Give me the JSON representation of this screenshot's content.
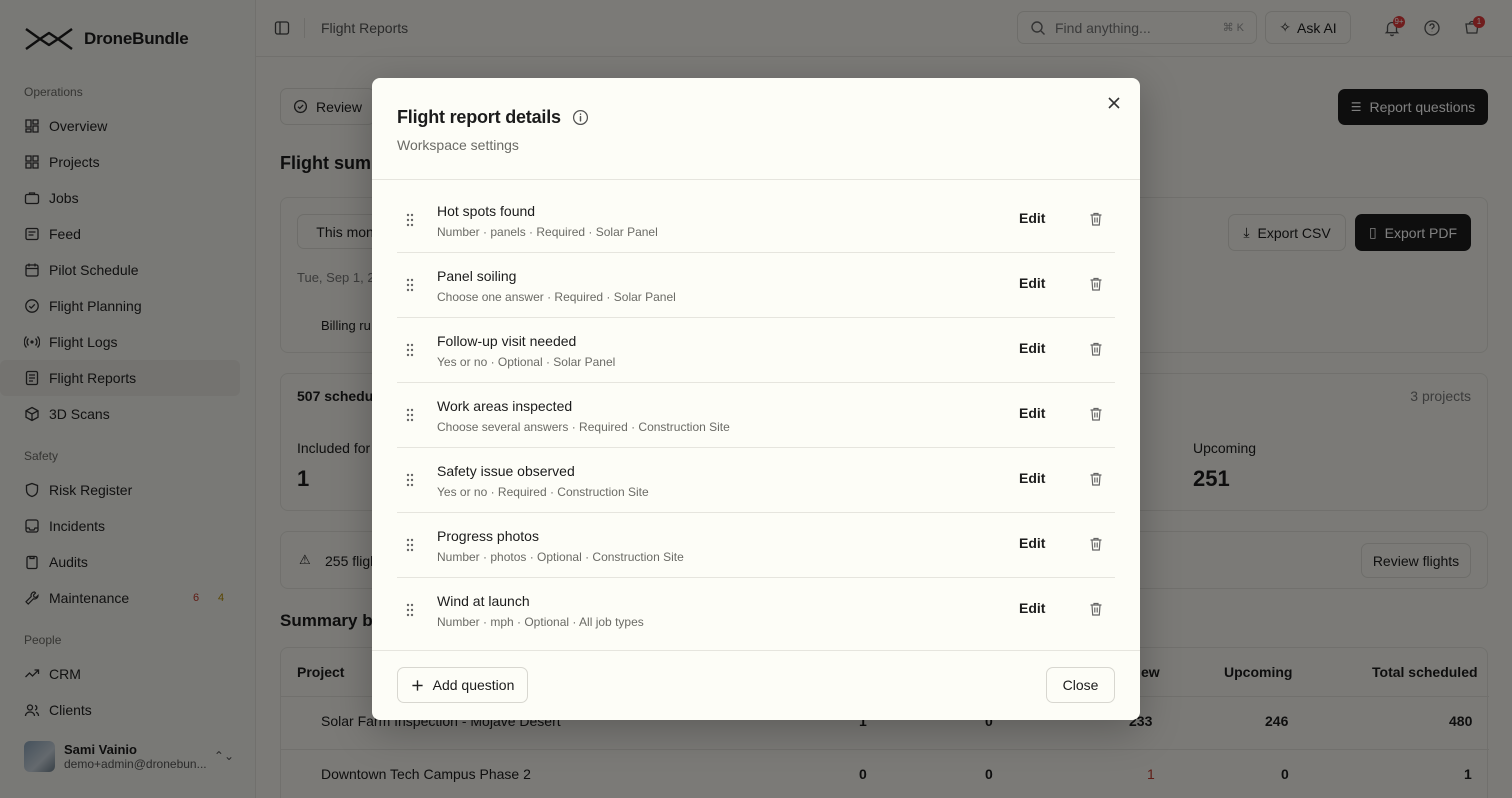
{
  "app": {
    "name": "DroneBundle"
  },
  "sidebar": {
    "groups": [
      {
        "heading": "Operations",
        "items": [
          {
            "label": "Overview",
            "icon": "dashboard-icon"
          },
          {
            "label": "Projects",
            "icon": "projects-icon"
          },
          {
            "label": "Jobs",
            "icon": "briefcase-icon"
          },
          {
            "label": "Feed",
            "icon": "feed-icon"
          },
          {
            "label": "Pilot Schedule",
            "icon": "calendar-icon"
          },
          {
            "label": "Flight Planning",
            "icon": "check-circle-icon"
          },
          {
            "label": "Flight Logs",
            "icon": "signal-icon"
          },
          {
            "label": "Flight Reports",
            "icon": "report-icon",
            "active": true
          },
          {
            "label": "3D Scans",
            "icon": "cube-icon"
          }
        ]
      },
      {
        "heading": "Safety",
        "items": [
          {
            "label": "Risk Register",
            "icon": "shield-icon"
          },
          {
            "label": "Incidents",
            "icon": "incident-icon"
          },
          {
            "label": "Audits",
            "icon": "clipboard-icon"
          },
          {
            "label": "Maintenance",
            "icon": "wrench-icon",
            "badge_red": "6",
            "badge_amber": "4"
          }
        ]
      },
      {
        "heading": "People",
        "items": [
          {
            "label": "CRM",
            "icon": "trend-icon"
          },
          {
            "label": "Clients",
            "icon": "users-icon"
          }
        ]
      }
    ],
    "user": {
      "name": "Sami Vainio",
      "email": "demo+admin@dronebun..."
    }
  },
  "topbar": {
    "breadcrumb": "Flight Reports",
    "search_placeholder": "Find anything...",
    "search_shortcut": "⌘ K",
    "ask_ai": "Ask AI",
    "notification_count": "9+",
    "cart_count": "1"
  },
  "main": {
    "review_button": "Review",
    "report_questions_button": "Report questions",
    "section_title": "Flight sum",
    "period_button": "This mont",
    "date_text": "Tue, Sep 1, 2",
    "billing_text": "Billing ru",
    "export_csv": "Export CSV",
    "export_pdf": "Export PDF",
    "scheduled_text": "507 schedul",
    "projects_count": "3 projects",
    "included_label": "Included for",
    "included_value": "1",
    "upcoming_label": "Upcoming",
    "upcoming_value": "251",
    "flights_alert": "255 fligh",
    "review_flights": "Review flights",
    "summary_title": "Summary by",
    "table": {
      "headers": [
        "Project",
        "ew",
        "Upcoming",
        "Total scheduled"
      ],
      "rows": [
        {
          "project": "Solar Farm Inspection - Mojave Desert",
          "c1": "1",
          "c2": "0",
          "c3": "233",
          "upcoming": "246",
          "total": "480"
        },
        {
          "project": "Downtown Tech Campus Phase 2",
          "c1": "0",
          "c2": "0",
          "c3": "1",
          "upcoming": "0",
          "total": "1"
        }
      ]
    }
  },
  "modal": {
    "title": "Flight report details",
    "subtitle": "Workspace settings",
    "edit_label": "Edit",
    "add_question": "Add question",
    "close": "Close",
    "questions": [
      {
        "title": "Hot spots found",
        "meta": "Number · panels · Required · Solar Panel"
      },
      {
        "title": "Panel soiling",
        "meta": "Choose one answer · Required · Solar Panel"
      },
      {
        "title": "Follow-up visit needed",
        "meta": "Yes or no · Optional · Solar Panel"
      },
      {
        "title": "Work areas inspected",
        "meta": "Choose several answers · Required · Construction Site"
      },
      {
        "title": "Safety issue observed",
        "meta": "Yes or no · Required · Construction Site"
      },
      {
        "title": "Progress photos",
        "meta": "Number · photos · Optional · Construction Site"
      },
      {
        "title": "Wind at launch",
        "meta": "Number · mph · Optional · All job types"
      }
    ]
  }
}
